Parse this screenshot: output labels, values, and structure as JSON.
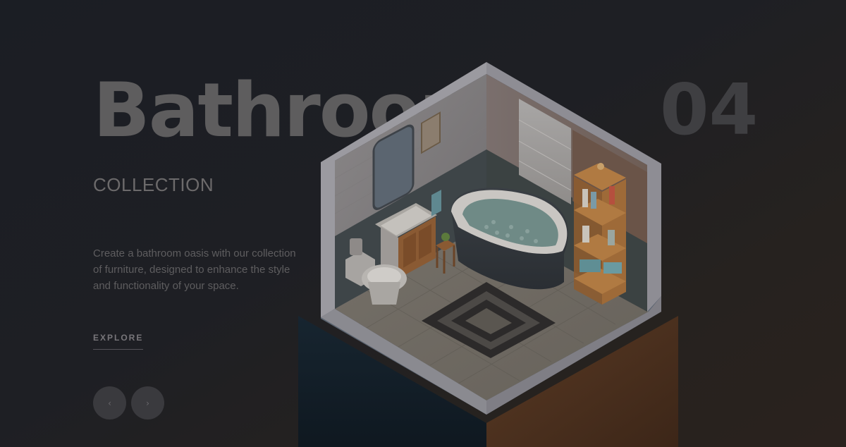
{
  "hero": {
    "title": "Bathroom",
    "number": "04",
    "subtitle": "COLLECTION",
    "description": "Create a bathroom oasis with our collection of furniture, designed to enhance the style and functionality of your space.",
    "cta_label": "EXPLORE"
  },
  "nav": {
    "prev_glyph": "‹",
    "next_glyph": "›"
  },
  "colors": {
    "background": "#1c1e23",
    "title": "#5e5d5e",
    "number": "#3f3f42",
    "text": "#5e5d5f",
    "button": "#3a3a3e"
  },
  "icons": {
    "prev": "chevron-left-icon",
    "next": "chevron-right-icon"
  }
}
